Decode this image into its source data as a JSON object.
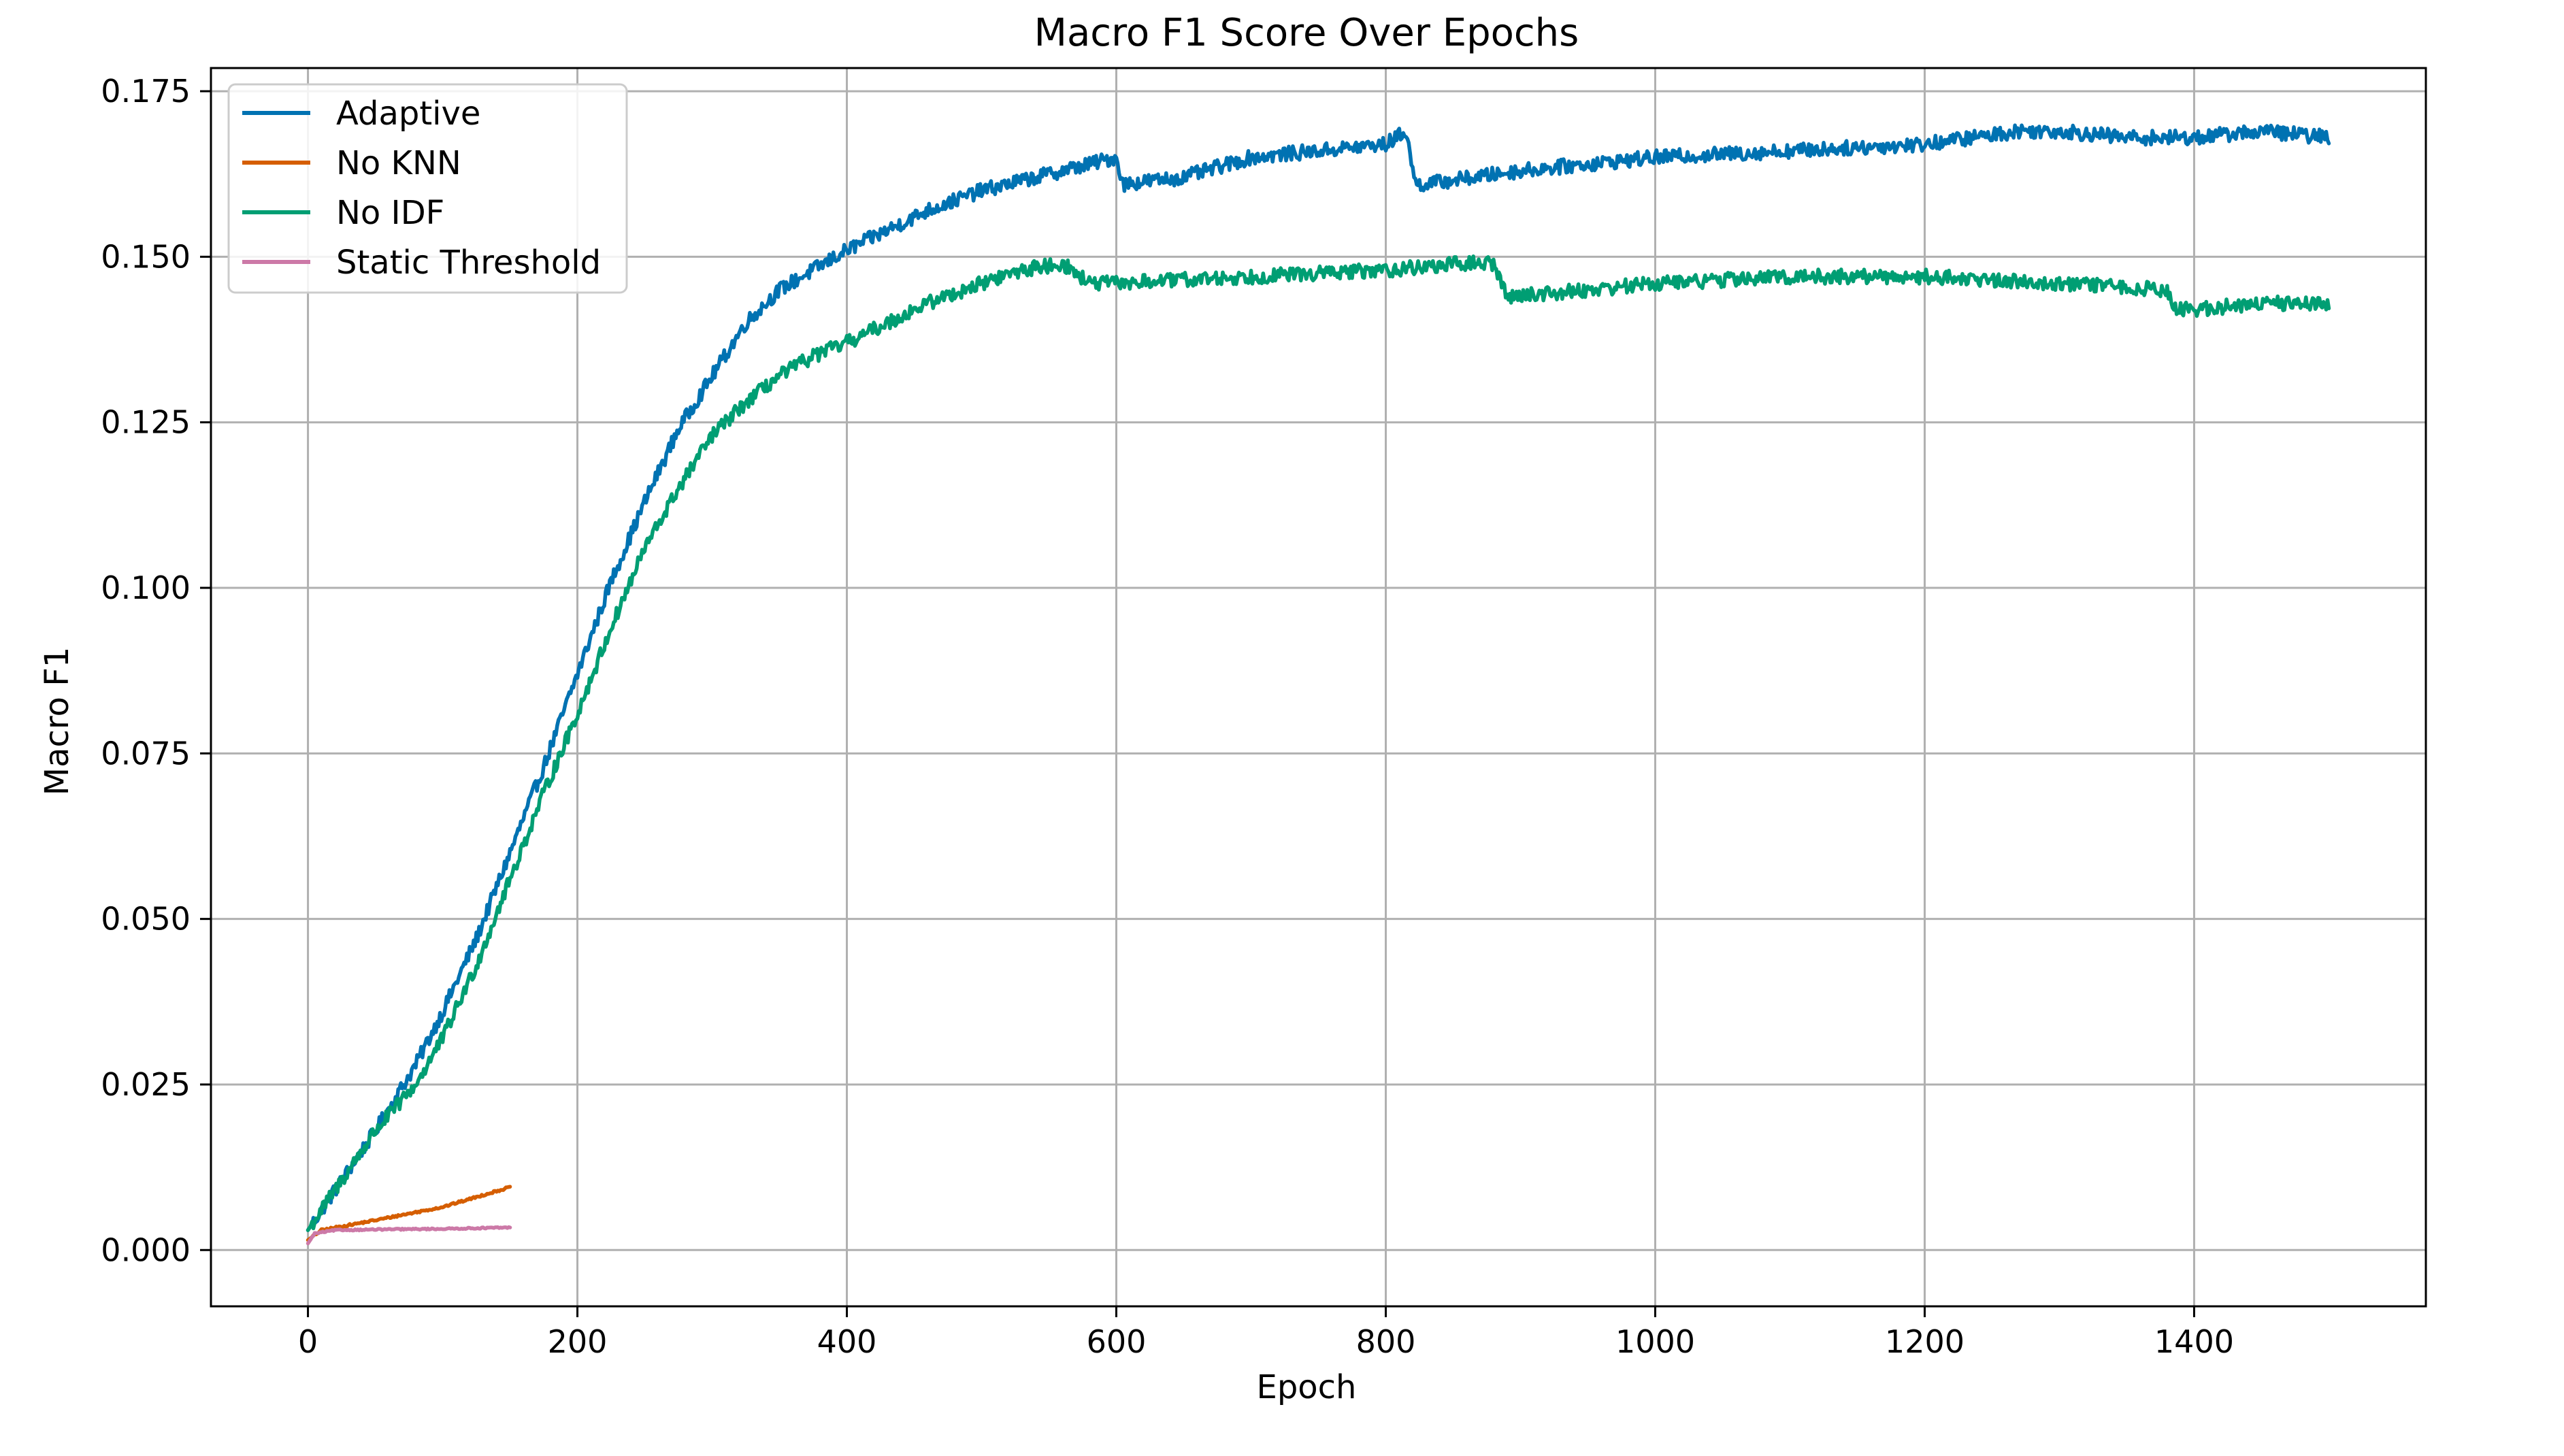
{
  "chart_data": {
    "type": "line",
    "title": "Macro F1 Score Over Epochs",
    "xlabel": "Epoch",
    "ylabel": "Macro F1",
    "xlim": [
      -72,
      1572
    ],
    "ylim": [
      -0.0085,
      0.1785
    ],
    "xticks": [
      0,
      200,
      400,
      600,
      800,
      1000,
      1200,
      1400
    ],
    "yticks": [
      0.0,
      0.025,
      0.05,
      0.075,
      0.1,
      0.125,
      0.15,
      0.175
    ],
    "xtick_labels": [
      "0",
      "200",
      "400",
      "600",
      "800",
      "1000",
      "1200",
      "1400"
    ],
    "ytick_labels": [
      "0.000",
      "0.025",
      "0.050",
      "0.075",
      "0.100",
      "0.125",
      "0.150",
      "0.175"
    ],
    "grid": true,
    "legend_position": "top-left",
    "series": [
      {
        "name": "Adaptive",
        "color": "#0072b2",
        "noise": 0.0011,
        "x": [
          0,
          20,
          50,
          80,
          100,
          125,
          150,
          175,
          200,
          225,
          250,
          275,
          300,
          325,
          350,
          375,
          400,
          430,
          460,
          500,
          540,
          580,
          600,
          605,
          650,
          700,
          750,
          800,
          815,
          822,
          830,
          900,
          1000,
          1100,
          1200,
          1270,
          1300,
          1350,
          1400,
          1450,
          1500
        ],
        "values": [
          0.003,
          0.009,
          0.018,
          0.028,
          0.036,
          0.047,
          0.06,
          0.073,
          0.087,
          0.101,
          0.113,
          0.124,
          0.132,
          0.14,
          0.145,
          0.148,
          0.151,
          0.154,
          0.157,
          0.16,
          0.162,
          0.164,
          0.165,
          0.161,
          0.162,
          0.165,
          0.166,
          0.167,
          0.169,
          0.161,
          0.161,
          0.163,
          0.165,
          0.166,
          0.167,
          0.169,
          0.169,
          0.168,
          0.168,
          0.169,
          0.168
        ]
      },
      {
        "name": "No KNN",
        "color": "#d55e00",
        "noise": 0.00015,
        "x": [
          0,
          10,
          50,
          100,
          150
        ],
        "values": [
          0.0015,
          0.003,
          0.0045,
          0.0065,
          0.0095
        ]
      },
      {
        "name": "No IDF",
        "color": "#009e73",
        "noise": 0.0011,
        "x": [
          0,
          20,
          50,
          80,
          100,
          125,
          150,
          175,
          200,
          225,
          250,
          275,
          300,
          325,
          350,
          375,
          400,
          430,
          460,
          500,
          530,
          560,
          580,
          600,
          700,
          800,
          860,
          880,
          890,
          950,
          1000,
          1100,
          1200,
          1300,
          1380,
          1385,
          1400,
          1450,
          1500
        ],
        "values": [
          0.003,
          0.009,
          0.018,
          0.025,
          0.032,
          0.043,
          0.056,
          0.069,
          0.081,
          0.094,
          0.106,
          0.115,
          0.123,
          0.128,
          0.132,
          0.135,
          0.137,
          0.14,
          0.143,
          0.146,
          0.148,
          0.149,
          0.146,
          0.146,
          0.147,
          0.148,
          0.149,
          0.149,
          0.144,
          0.145,
          0.146,
          0.147,
          0.147,
          0.146,
          0.145,
          0.142,
          0.142,
          0.143,
          0.143
        ]
      },
      {
        "name": "Static Threshold",
        "color": "#cc79a7",
        "noise": 0.0001,
        "x": [
          0,
          5,
          20,
          50,
          100,
          150
        ],
        "values": [
          0.001,
          0.0025,
          0.003,
          0.0031,
          0.0032,
          0.0034
        ]
      }
    ]
  }
}
